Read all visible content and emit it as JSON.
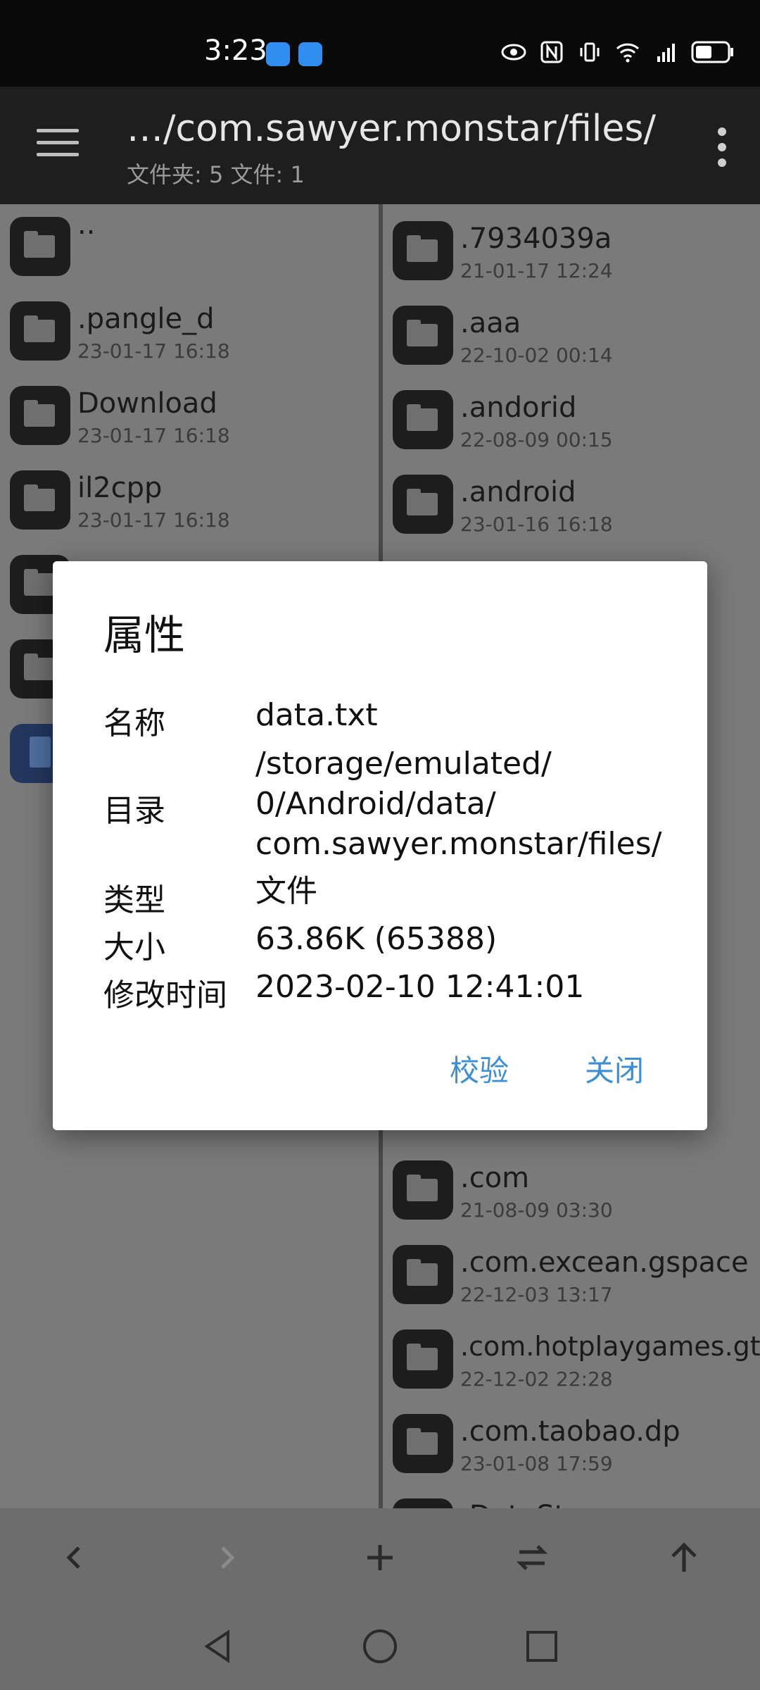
{
  "status_bar": {
    "time": "3:23",
    "icons": [
      "weather-icon",
      "cloud-icon",
      "eye-icon",
      "nfc-icon",
      "vibrate-icon",
      "wifi-icon",
      "5g-signal-icon",
      "battery-icon"
    ]
  },
  "app_bar": {
    "title": "…/com.sawyer.monstar/files/",
    "subtitle": "文件夹: 5  文件: 1"
  },
  "left_pane": [
    {
      "name": "..",
      "date": "",
      "type": "folder"
    },
    {
      "name": ".pangle_d",
      "date": "23-01-17 16:18",
      "type": "folder"
    },
    {
      "name": "Download",
      "date": "23-01-17 16:18",
      "type": "folder"
    },
    {
      "name": "il2cpp",
      "date": "23-01-17 16:18",
      "type": "folder"
    },
    {
      "name": "",
      "date": "",
      "type": "folder"
    },
    {
      "name": "",
      "date": "",
      "type": "folder"
    },
    {
      "name": "",
      "date": "",
      "type": "file"
    }
  ],
  "right_pane_top": [
    {
      "name": ".7934039a",
      "date": "21-01-17 12:24"
    },
    {
      "name": ".aaa",
      "date": "22-10-02 00:14"
    },
    {
      "name": ".andorid",
      "date": "22-08-09 00:15"
    },
    {
      "name": ".android",
      "date": "23-01-16 16:18"
    }
  ],
  "right_pane_bottom": [
    {
      "name": ".com",
      "date": "21-08-09 03:30"
    },
    {
      "name": ".com.excean.gspace",
      "date": "22-12-03 13:17"
    },
    {
      "name": ".com.hotplaygames.gt",
      "date": "22-12-02 22:28"
    },
    {
      "name": ".com.taobao.dp",
      "date": "23-01-08 17:59"
    },
    {
      "name": ".DataStorage",
      "date": ""
    }
  ],
  "dialog": {
    "title": "属性",
    "labels": {
      "name": "名称",
      "dir": "目录",
      "type": "类型",
      "size": "大小",
      "modified": "修改时间"
    },
    "values": {
      "name": "data.txt",
      "dir_line1": "/storage/emulated/",
      "dir_line2": "0/Android/data/",
      "dir_line3": "com.sawyer.monstar/files/",
      "type": "文件",
      "size": "63.86K (65388)",
      "modified": "2023-02-10 12:41:01"
    },
    "buttons": {
      "verify": "校验",
      "close": "关闭"
    },
    "button_color": "#3b8fd6"
  }
}
